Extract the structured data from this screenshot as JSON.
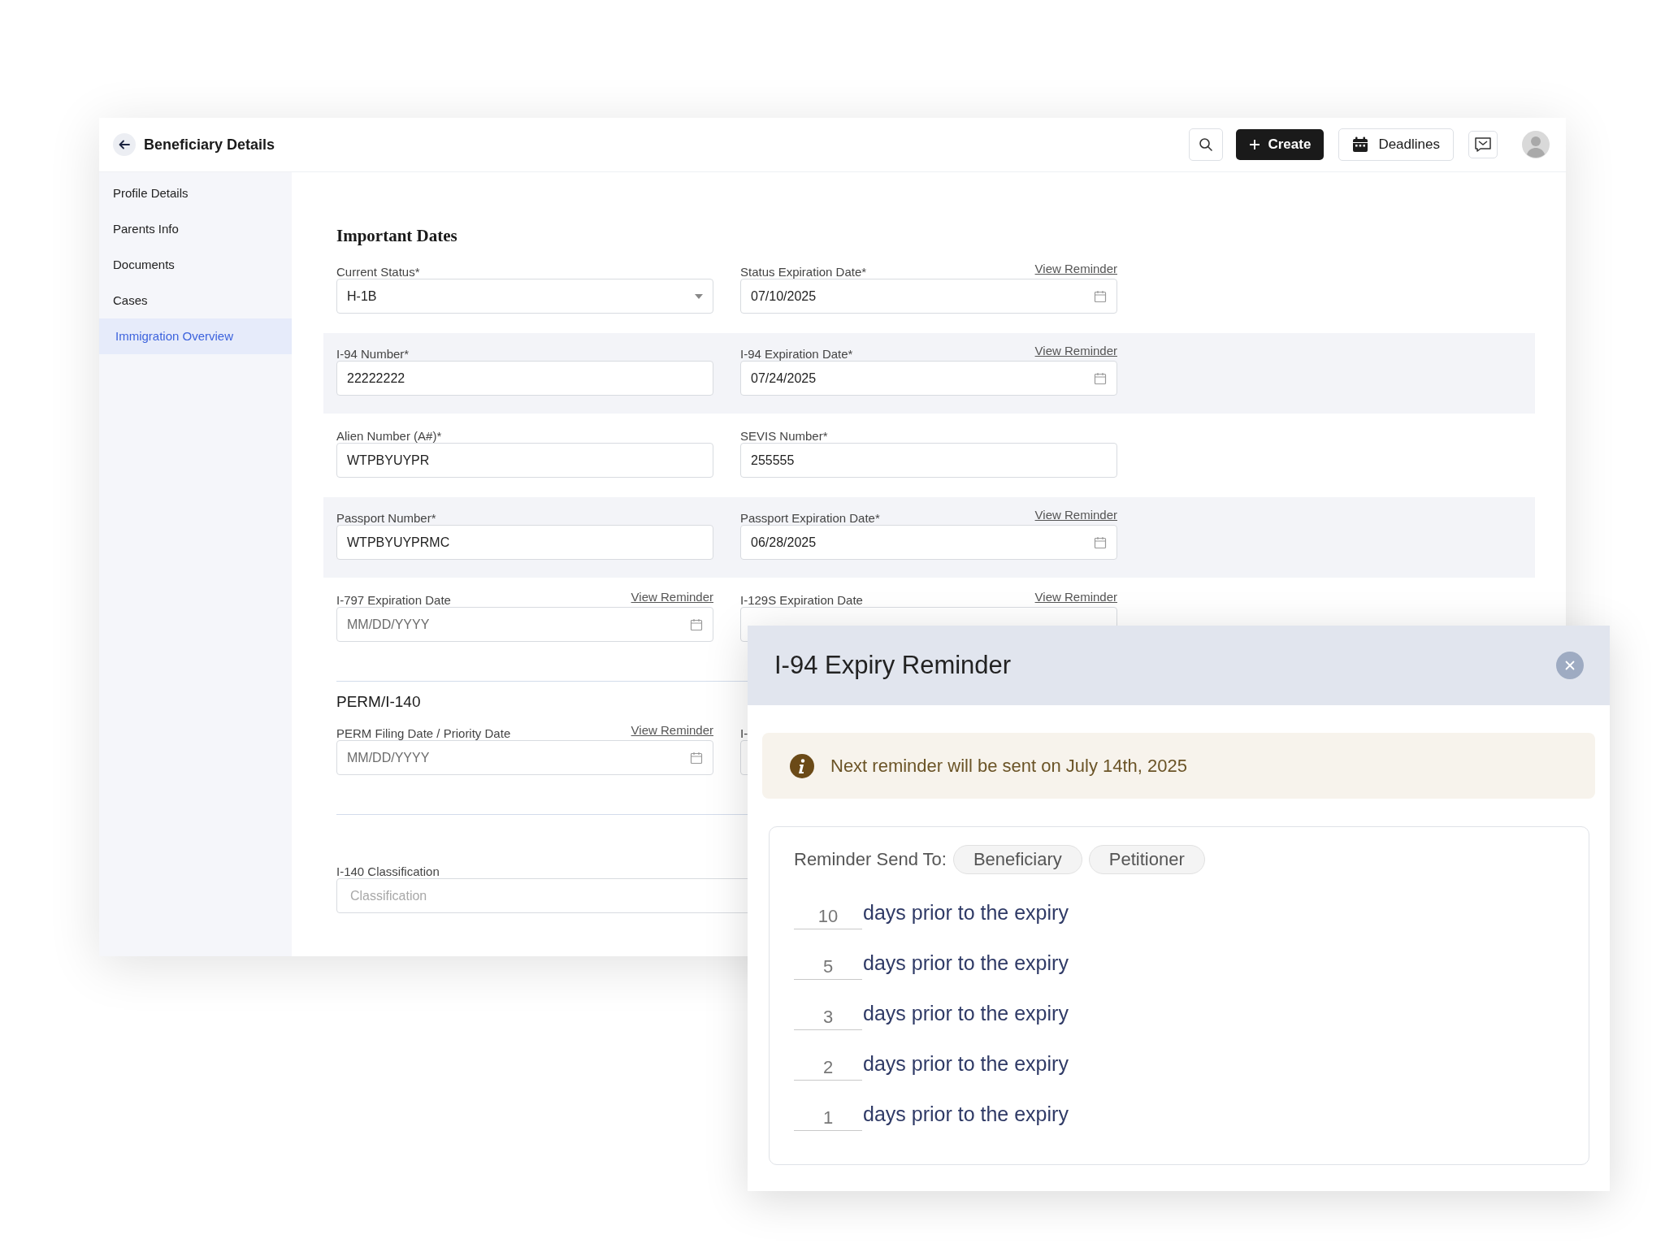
{
  "header": {
    "title": "Beneficiary Details",
    "create_label": "Create",
    "deadlines_label": "Deadlines"
  },
  "sidebar": {
    "items": [
      {
        "label": "Profile Details",
        "selected": false
      },
      {
        "label": "Parents Info",
        "selected": false
      },
      {
        "label": "Documents",
        "selected": false
      },
      {
        "label": "Cases",
        "selected": false
      },
      {
        "label": "Immigration Overview",
        "selected": true
      }
    ]
  },
  "sections": [
    {
      "kind": "primary",
      "title": "Important Dates",
      "rows": [
        {
          "shaded": false,
          "fields": [
            {
              "kind": "select",
              "label": "Current Status*",
              "value": "H-1B"
            },
            {
              "kind": "date",
              "label": "Status Expiration Date*",
              "value": "07/10/2025",
              "link": "View Reminder"
            }
          ]
        },
        {
          "shaded": true,
          "fields": [
            {
              "kind": "text",
              "label": "I-94 Number*",
              "value": "22222222"
            },
            {
              "kind": "date",
              "label": "I-94 Expiration Date*",
              "value": "07/24/2025",
              "link": "View Reminder"
            }
          ]
        },
        {
          "shaded": false,
          "fields": [
            {
              "kind": "text",
              "label": "Alien Number (A#)*",
              "value": "WTPBYUYPR"
            },
            {
              "kind": "text",
              "label": "SEVIS Number*",
              "value": "255555"
            }
          ]
        },
        {
          "shaded": true,
          "fields": [
            {
              "kind": "text",
              "label": "Passport Number*",
              "value": "WTPBYUYPRMC"
            },
            {
              "kind": "date",
              "label": "Passport Expiration Date*",
              "value": "06/28/2025",
              "link": "View Reminder"
            }
          ]
        },
        {
          "shaded": false,
          "fields": [
            {
              "kind": "date",
              "label": "I-797 Expiration Date",
              "placeholder": "MM/DD/YYYY",
              "link": "View Reminder"
            },
            {
              "kind": "date",
              "label": "I-129S Expiration Date",
              "link": "View Reminder"
            }
          ]
        }
      ]
    },
    {
      "kind": "secondary",
      "title": "PERM/I-140",
      "rows": [
        {
          "shaded": false,
          "fields": [
            {
              "kind": "date",
              "label": "PERM Filing Date / Priority Date",
              "placeholder": "MM/DD/YYYY",
              "link": "View Reminder"
            },
            {
              "kind": "text",
              "label": "I-"
            }
          ]
        }
      ]
    },
    {
      "kind": "plain",
      "rows": [
        {
          "shaded": false,
          "fields": [
            {
              "kind": "text",
              "label": "I-140 Classification",
              "placeholder": "Classification"
            }
          ]
        }
      ]
    }
  ],
  "modal": {
    "title": "I-94 Expiry Reminder",
    "notice": "Next reminder will be sent on July 14th, 2025",
    "send_to_label": "Reminder Send To:",
    "recipients": [
      "Beneficiary",
      "Petitioner"
    ],
    "reminders": [
      {
        "days": "10",
        "text": "days prior to the expiry"
      },
      {
        "days": "5",
        "text": "days prior to the expiry"
      },
      {
        "days": "3",
        "text": "days prior to the expiry"
      },
      {
        "days": "2",
        "text": "days prior to the expiry"
      },
      {
        "days": "1",
        "text": "days prior to the expiry"
      }
    ]
  }
}
